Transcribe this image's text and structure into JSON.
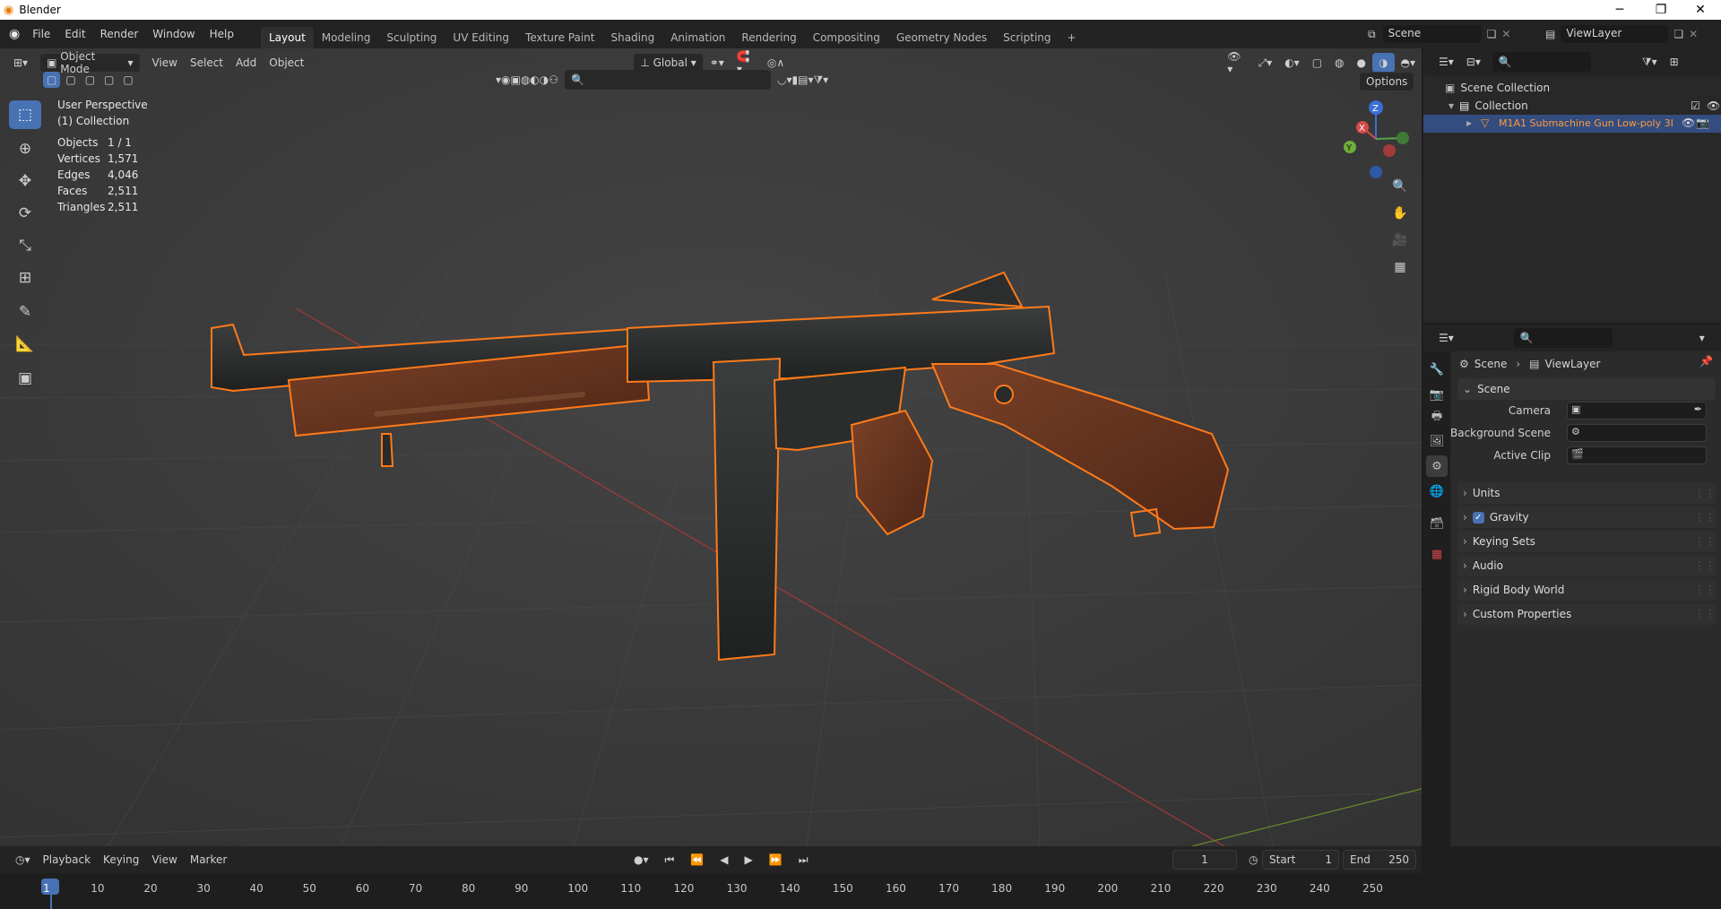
{
  "window": {
    "title": "Blender",
    "app_icon": "blender-logo"
  },
  "menu": [
    "File",
    "Edit",
    "Render",
    "Window",
    "Help"
  ],
  "workspaces": [
    "Layout",
    "Modeling",
    "Sculpting",
    "UV Editing",
    "Texture Paint",
    "Shading",
    "Animation",
    "Rendering",
    "Compositing",
    "Geometry Nodes",
    "Scripting",
    "+"
  ],
  "active_workspace": "Layout",
  "scene_selector": {
    "scene": "Scene",
    "view_layer": "ViewLayer"
  },
  "viewport_header": {
    "mode": "Object Mode",
    "menus": [
      "View",
      "Select",
      "Add",
      "Object"
    ],
    "orientation": "Global",
    "options_label": "Options"
  },
  "overlay": {
    "perspective": "User Perspective",
    "collection": "(1) Collection",
    "stats": [
      {
        "label": "Objects",
        "value": "1 / 1"
      },
      {
        "label": "Vertices",
        "value": "1,571"
      },
      {
        "label": "Edges",
        "value": "4,046"
      },
      {
        "label": "Faces",
        "value": "2,511"
      },
      {
        "label": "Triangles",
        "value": "2,511"
      }
    ]
  },
  "gizmo": {
    "z": "Z",
    "x": "X",
    "y": "Y"
  },
  "outliner": {
    "root": "Scene Collection",
    "collection": "Collection",
    "object": "M1A1 Submachine Gun Low-poly 3I"
  },
  "properties": {
    "breadcrumb": [
      "Scene",
      "ViewLayer"
    ],
    "section": "Scene",
    "fields": [
      {
        "label": "Camera"
      },
      {
        "label": "Background Scene"
      },
      {
        "label": "Active Clip"
      }
    ],
    "panels": [
      "Units",
      "Gravity",
      "Keying Sets",
      "Audio",
      "Rigid Body World",
      "Custom Properties"
    ],
    "gravity_checked": true
  },
  "timeline": {
    "menus": [
      "Playback",
      "Keying",
      "View",
      "Marker"
    ],
    "current_frame": "1",
    "start_label": "Start",
    "start": "1",
    "end_label": "End",
    "end": "250",
    "ticks": [
      "1",
      "10",
      "20",
      "30",
      "40",
      "50",
      "60",
      "70",
      "80",
      "90",
      "100",
      "110",
      "120",
      "130",
      "140",
      "150",
      "160",
      "170",
      "180",
      "190",
      "200",
      "210",
      "220",
      "230",
      "240",
      "250"
    ]
  },
  "colors": {
    "accent": "#4772b3",
    "selection_outline": "#ff7a1a",
    "wood": "#6b3a22"
  }
}
